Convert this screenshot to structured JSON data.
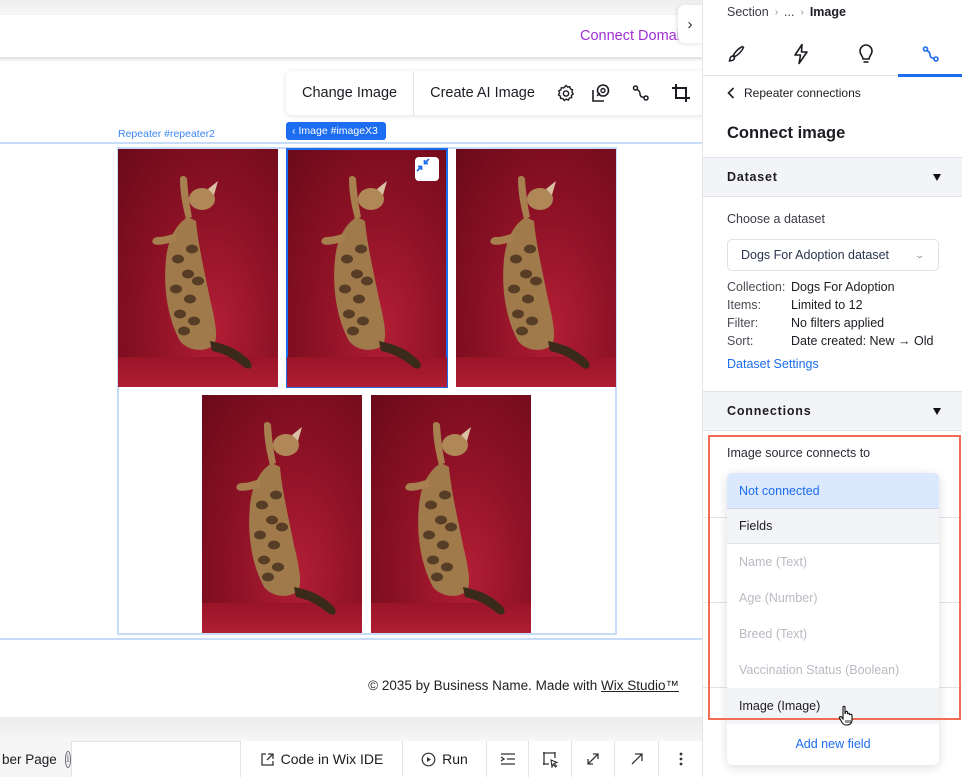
{
  "header": {
    "connect_domain": "Connect Domain"
  },
  "toolbar": {
    "change_image": "Change Image",
    "create_ai_image": "Create AI Image",
    "icons": [
      "gear-icon",
      "animation-icon",
      "connect-data-icon",
      "crop-icon"
    ]
  },
  "canvas": {
    "repeater_label": "Repeater #repeater2",
    "image_tag": "Image #imageX3",
    "image_tag_chevron": "‹",
    "tiles_count": 5,
    "selected_tile": 2,
    "footer_text": "© 2035 by Business Name. Made with ",
    "footer_link": "Wix Studio™"
  },
  "bottom_bar": {
    "page_name": "ber Page",
    "info": "i",
    "code_in_ide": "Code in Wix IDE",
    "run": "Run"
  },
  "panel": {
    "breadcrumb": [
      "Section",
      "...",
      "Image"
    ],
    "breadcrumb_sep": "›",
    "tabs": [
      "design-tab",
      "interactions-tab",
      "tips-tab",
      "connect-tab"
    ],
    "active_tab": 3,
    "back_label": "Repeater connections",
    "title": "Connect image",
    "dataset_section": {
      "title": "Dataset",
      "choose_label": "Choose a dataset",
      "selected_dataset": "Dogs For Adoption dataset",
      "meta": [
        {
          "key": "Collection:",
          "value": "Dogs For Adoption"
        },
        {
          "key": "Items:",
          "value": "Limited to 12"
        },
        {
          "key": "Filter:",
          "value": "No filters applied"
        },
        {
          "key": "Sort:",
          "value": "Date created: New → Old"
        }
      ],
      "settings_link": "Dataset Settings"
    },
    "connections_section": {
      "title": "Connections",
      "image_source_label": "Image source connects to",
      "dropdown": {
        "selected": "Not connected",
        "group_label": "Fields",
        "options": [
          {
            "label": "Name (Text)",
            "disabled": true
          },
          {
            "label": "Age (Number)",
            "disabled": true
          },
          {
            "label": "Breed (Text)",
            "disabled": true
          },
          {
            "label": "Vaccination Status (Boolean)",
            "disabled": true
          },
          {
            "label": "Image (Image)",
            "disabled": false,
            "hovered": true
          }
        ],
        "add_new_field": "Add new field"
      }
    }
  },
  "colors": {
    "accent": "#1c6df0",
    "connect_domain": "#a030d6",
    "highlight": "#f26b55",
    "repeater_outline": "#c6dcf8"
  }
}
